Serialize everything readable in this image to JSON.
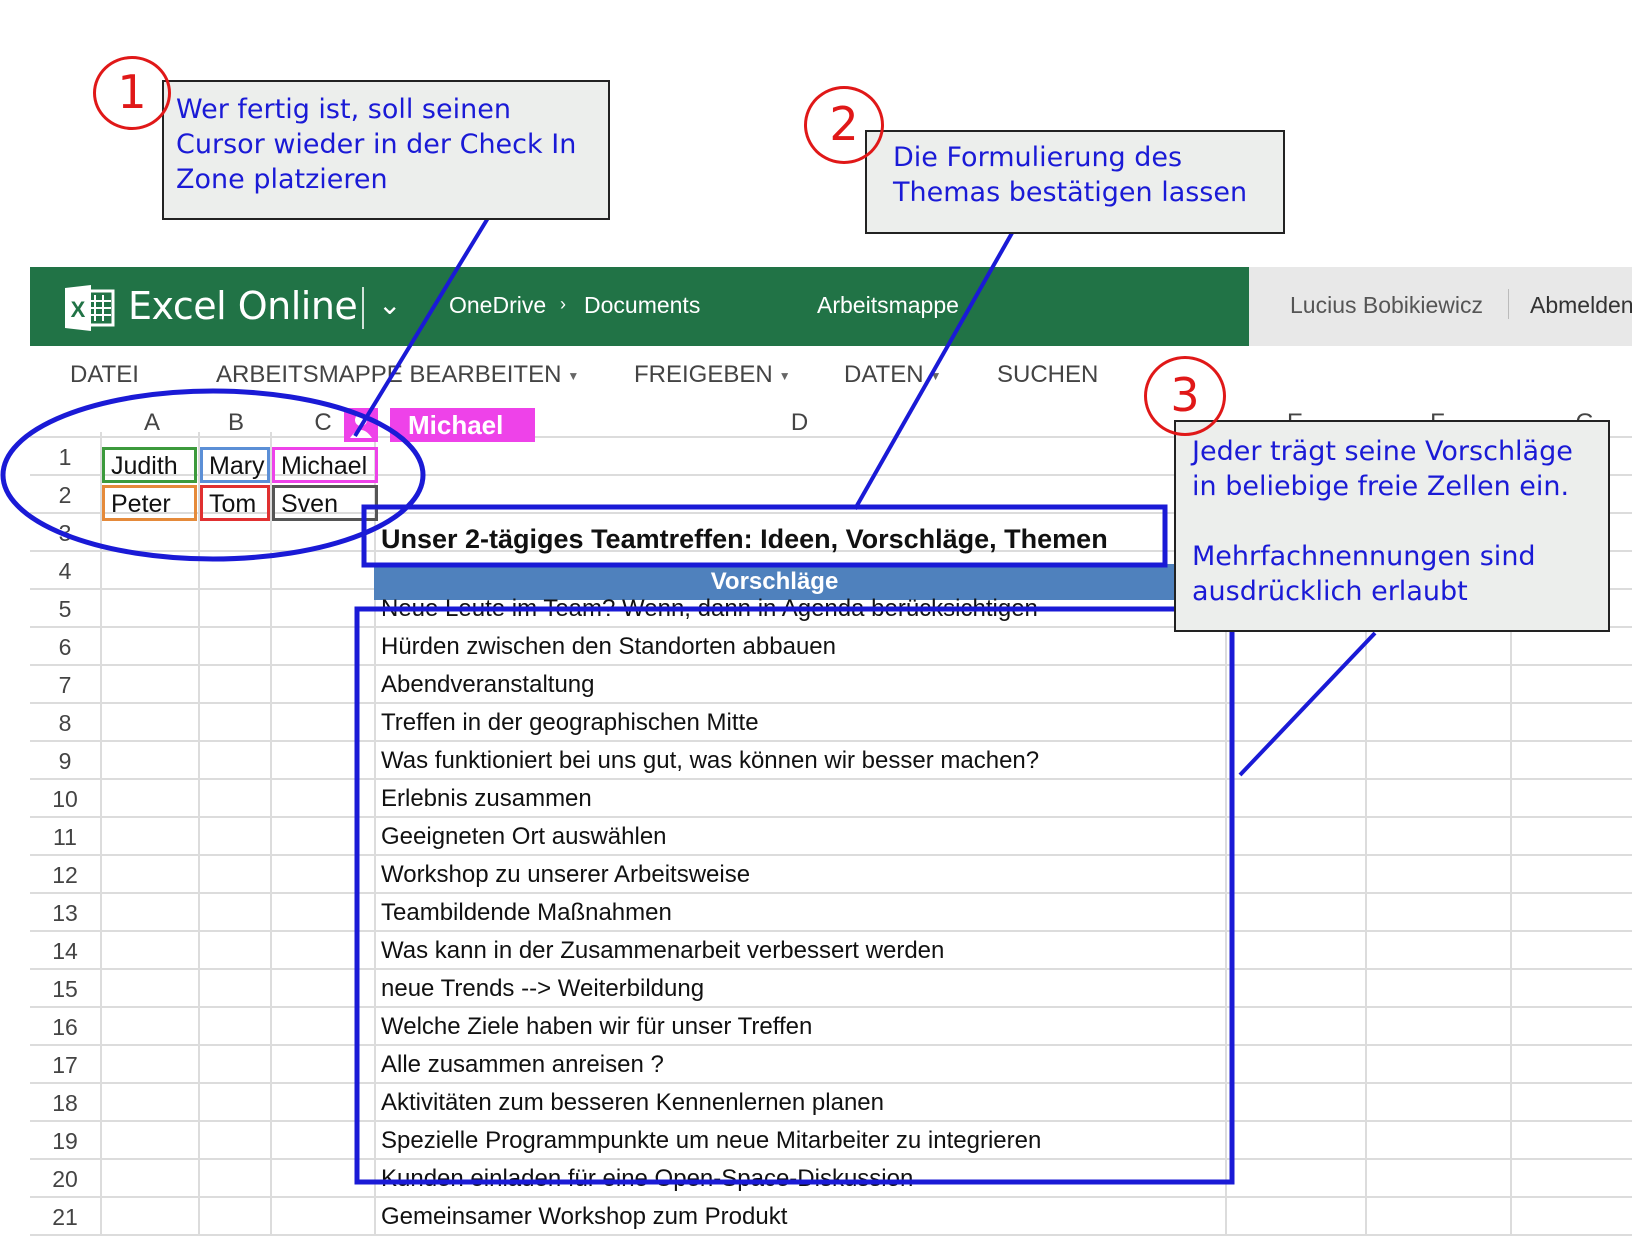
{
  "header": {
    "app_name": "Excel Online",
    "breadcrumb": [
      "OneDrive",
      "Documents"
    ],
    "workbook": "Arbeitsmappe",
    "user": "Lucius Bobikiewicz",
    "logout": "Abmelden",
    "logo_letter": "X"
  },
  "ribbon": {
    "file": "DATEI",
    "edit": "ARBEITSMAPPE BEARBEITEN",
    "share": "FREIGEBEN",
    "data": "DATEN",
    "search": "SUCHEN"
  },
  "columns": [
    "A",
    "B",
    "C",
    "D",
    "E",
    "F",
    "G"
  ],
  "rows": [
    "1",
    "2",
    "3",
    "4",
    "5",
    "6",
    "7",
    "8",
    "9",
    "10",
    "11",
    "12",
    "13",
    "14",
    "15",
    "16",
    "17",
    "18",
    "19",
    "20",
    "21"
  ],
  "presence": {
    "name": "Michael"
  },
  "checkin": {
    "row1": [
      "Judith",
      "Mary",
      "Michael"
    ],
    "row2": [
      "Peter",
      "Tom",
      "Sven"
    ]
  },
  "sheet": {
    "title": "Unser 2-tägiges Teamtreffen: Ideen, Vorschläge, Themen",
    "header": "Vorschläge",
    "entries": [
      "Neue Leute im Team? Wenn, dann in Agenda berücksichtigen",
      "Hürden zwischen den Standorten abbauen",
      "Abendveranstaltung",
      "Treffen in der geographischen Mitte",
      "Was funktioniert bei uns gut, was können wir besser machen?",
      "Erlebnis zusammen",
      "Geeigneten Ort auswählen",
      "Workshop zu unserer Arbeitsweise",
      "Teambildende Maßnahmen",
      "Was kann in der Zusammenarbeit verbessert werden",
      "neue Trends --> Weiterbildung",
      "Welche Ziele haben wir für unser Treffen",
      "Alle zusammen anreisen ?",
      "Aktivitäten zum besseren Kennenlernen planen",
      "Spezielle Programmpunkte um neue Mitarbeiter zu integrieren",
      "Kunden einladen für eine Open-Space-Diskussion",
      "Gemeinsamer Workshop zum Produkt"
    ]
  },
  "annotations": {
    "one": {
      "number": "1",
      "text": "Wer fertig ist, soll seinen\nCursor wieder in der Check In\nZone platzieren"
    },
    "two": {
      "number": "2",
      "text": "Die Formulierung des\nThemas bestätigen lassen"
    },
    "three": {
      "number": "3",
      "text": "Jeder trägt seine Vorschläge\nin beliebige freie Zellen ein.\n\nMehrfachnennungen sind\nausdrücklich erlaubt"
    }
  },
  "colors": {
    "excel_green": "#217346",
    "header_blue": "#4f81bd",
    "presence_pink": "#ee42e9",
    "annotation_blue": "#1a1ad6",
    "annotation_red": "#e01818"
  }
}
